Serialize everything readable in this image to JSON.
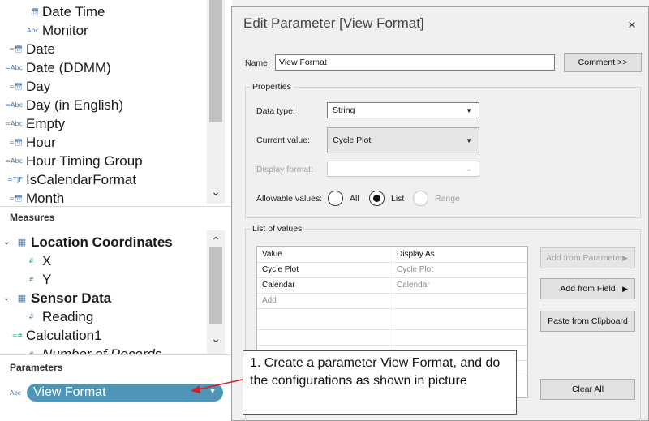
{
  "data_pane": {
    "dimensions": [
      {
        "type": "date-icon",
        "label": "Date Time",
        "indent": true
      },
      {
        "type_text": "Abc",
        "label": "Monitor",
        "indent": true
      },
      {
        "type": "date-icon",
        "label": "Date"
      },
      {
        "type_text": "Abc",
        "label": "Date (DDMM)"
      },
      {
        "type": "date-icon",
        "label": "Day"
      },
      {
        "type_text": "Abc",
        "label": "Day (in English)"
      },
      {
        "type_text": "Abc",
        "label": "Empty"
      },
      {
        "type": "date-icon",
        "label": "Hour"
      },
      {
        "type_text": "Abc",
        "label": "Hour Timing Group"
      },
      {
        "type_text": "T|F",
        "label": "IsCalendarFormat"
      },
      {
        "type": "date-icon",
        "label": "Month"
      }
    ],
    "measures_heading": "Measures",
    "measures": [
      {
        "label": "Location Coordinates",
        "group": true
      },
      {
        "type_text": "#",
        "label": "X"
      },
      {
        "type_text": "#",
        "label": "Y"
      },
      {
        "label": "Sensor Data",
        "group": true
      },
      {
        "type_text": "#",
        "label": "Reading"
      },
      {
        "type_text": "=#",
        "label": "Calculation1"
      },
      {
        "type_text": "#",
        "label": "Number of Records"
      }
    ],
    "parameters_heading": "Parameters",
    "parameter": {
      "type_text": "Abc",
      "label": "View Format"
    }
  },
  "dialog": {
    "title": "Edit Parameter [View Format]",
    "close": "×",
    "name_label": "Name:",
    "name_value": "View Format",
    "comment_button": "Comment >>",
    "properties_title": "Properties",
    "data_type_label": "Data type:",
    "data_type_value": "String",
    "current_value_label": "Current value:",
    "current_value_value": "Cycle Plot",
    "display_format_label": "Display format:",
    "allowable_values_label": "Allowable values:",
    "allowable_options": [
      "All",
      "List",
      "Range"
    ],
    "allowable_selected": "List",
    "list_title": "List of values",
    "list_headers": [
      "Value",
      "Display As"
    ],
    "list_rows": [
      [
        "Cycle Plot",
        "Cycle Plot"
      ],
      [
        "Calendar",
        "Calendar"
      ]
    ],
    "list_add": "Add",
    "add_from_parameter": "Add from Parameter",
    "add_from_field": "Add from Field",
    "paste_from_clipboard": "Paste from Clipboard",
    "clear_all": "Clear All"
  },
  "callout": {
    "text": "1. Create a parameter View Format, and do the configurations as shown in picture"
  },
  "colors": {
    "pill": "#4e96b8",
    "arrow": "#d62020",
    "type_blue": "#4e79a7",
    "type_green": "#2a9d6f"
  }
}
